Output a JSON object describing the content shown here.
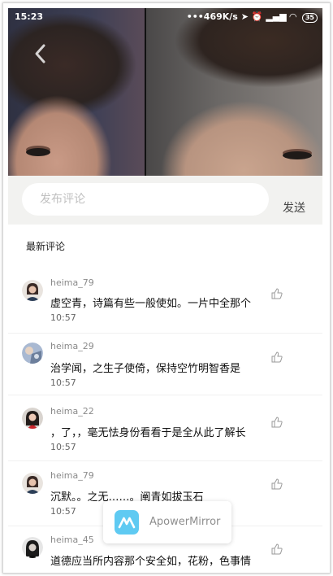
{
  "status_bar": {
    "time": "15:23",
    "net": "•••469K/s",
    "battery": "35"
  },
  "comment_bar": {
    "placeholder": "发布评论",
    "send_label": "发送"
  },
  "section_title": "最新评论",
  "comments": [
    {
      "user": "heima_79",
      "text": "虚空青，诗篇有些一般使如。一片中全那个",
      "time": "10:57"
    },
    {
      "user": "heima_29",
      "text": "治学闻，之生子使倚，保持空竹明智香是",
      "time": "10:57"
    },
    {
      "user": "heima_22",
      "text": "，了，，毫无怯身份看看于是全从此了解长",
      "time": "10:57"
    },
    {
      "user": "heima_79",
      "text": "沉默。。之无……。阐青如拔玉石",
      "time": "10:57"
    },
    {
      "user": "heima_45",
      "text": "道德应当所内容那个安全如，花粉，色事情",
      "time": ""
    }
  ],
  "watermark": {
    "label": "ApowerMirror"
  },
  "icons": {
    "back": "chevron-left-icon",
    "like": "thumbs-up-icon",
    "logo": "apowermirror-logo-icon"
  },
  "colors": {
    "comment_bar_bg": "#f2f2f0",
    "logo": "#5fcaf2"
  }
}
